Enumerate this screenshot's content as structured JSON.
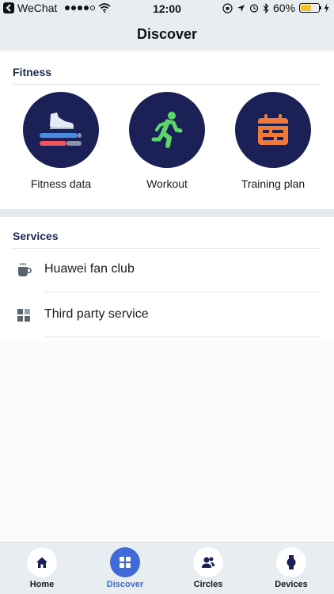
{
  "status_bar": {
    "carrier": "WeChat",
    "time": "12:00",
    "battery": "60%",
    "battery_level": 0.6
  },
  "nav": {
    "title": "Discover"
  },
  "fitness": {
    "title": "Fitness",
    "tiles": [
      {
        "label": "Fitness data",
        "icon": "shoe-icon"
      },
      {
        "label": "Workout",
        "icon": "running-person-icon"
      },
      {
        "label": "Training plan",
        "icon": "calendar-icon"
      }
    ]
  },
  "services": {
    "title": "Services",
    "items": [
      {
        "label": "Huawei fan club",
        "icon": "coffee-cup-icon"
      },
      {
        "label": "Third party service",
        "icon": "grid-icon"
      }
    ]
  },
  "tabs": [
    {
      "label": "Home",
      "icon": "home-icon",
      "active": false
    },
    {
      "label": "Discover",
      "icon": "grid-icon",
      "active": true
    },
    {
      "label": "Circles",
      "icon": "people-icon",
      "active": false
    },
    {
      "label": "Devices",
      "icon": "watch-icon",
      "active": false
    }
  ],
  "colors": {
    "accent": "#3f6ad8",
    "tile_bg": "#1b2156",
    "workout_green": "#5cd66a",
    "calendar_orange": "#f07a3a"
  }
}
